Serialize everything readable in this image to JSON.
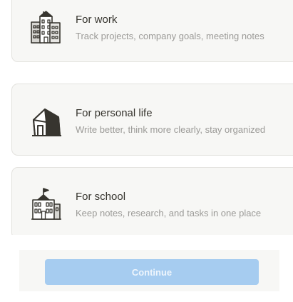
{
  "options": [
    {
      "title": "For work",
      "subtitle": "Track projects, company goals, meeting notes",
      "icon": "office-buildings-icon"
    },
    {
      "title": "For personal life",
      "subtitle": "Write better, think more clearly, stay organized",
      "icon": "house-icon"
    },
    {
      "title": "For school",
      "subtitle": "Keep notes, research, and tasks in one place",
      "icon": "school-building-icon"
    }
  ],
  "footer": {
    "continue_label": "Continue"
  },
  "colors": {
    "card_background": "#f7f7f5",
    "card_border": "#e3e2de",
    "title_text": "#37352f",
    "subtitle_text": "#9b9a97",
    "button_disabled": "#a6ccf0"
  }
}
